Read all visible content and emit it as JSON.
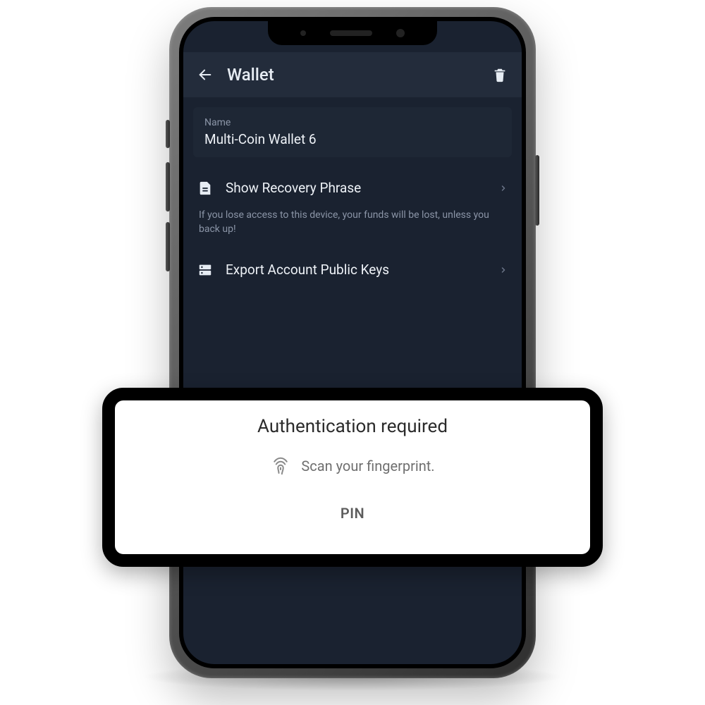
{
  "header": {
    "title": "Wallet"
  },
  "nameField": {
    "label": "Name",
    "value": "Multi-Coin Wallet 6"
  },
  "rows": {
    "recovery": {
      "label": "Show Recovery Phrase"
    },
    "recoveryHint": "If you lose access to this device, your funds will be lost, unless you back up!",
    "export": {
      "label": "Export Account Public Keys"
    }
  },
  "auth": {
    "title": "Authentication required",
    "message": "Scan your fingerprint.",
    "pinLabel": "PIN"
  }
}
